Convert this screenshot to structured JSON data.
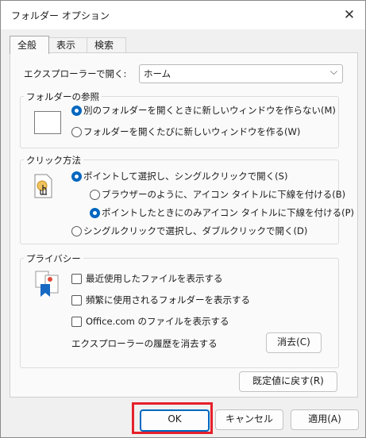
{
  "window": {
    "title": "フォルダー オプション",
    "close_glyph": "✕"
  },
  "tabs": [
    "全般",
    "表示",
    "検索"
  ],
  "general": {
    "open_in_label": "エクスプローラーで開く:",
    "open_in_value": "ホーム",
    "browse_folders": {
      "title": "フォルダーの参照",
      "option_same_window": "別のフォルダーを開くときに新しいウィンドウを作らない(M)",
      "option_new_window": "フォルダーを開くたびに新しいウィンドウを作る(W)",
      "selected": "option_same_window"
    },
    "click_items": {
      "title": "クリック方法",
      "option_single_click": "ポイントして選択し、シングルクリックで開く(S)",
      "sub_option_browser": "ブラウザーのように、アイコン タイトルに下線を付ける(B)",
      "sub_option_point": "ポイントしたときにのみアイコン タイトルに下線を付ける(P)",
      "option_double_click": "シングルクリックで選択し、ダブルクリックで開く(D)",
      "selected": "option_single_click",
      "sub_selected": "sub_option_point"
    },
    "privacy": {
      "title": "プライバシー",
      "check_recent_files": "最近使用したファイルを表示する",
      "check_frequent_folders": "頻繁に使用されるフォルダーを表示する",
      "check_office": "Office.com のファイルを表示する",
      "check_recent_files_checked": false,
      "check_frequent_folders_checked": false,
      "check_office_checked": false,
      "clear_history_label": "エクスプローラーの履歴を消去する",
      "clear_button": "消去(C)"
    },
    "restore_defaults_button": "既定値に戻す(R)"
  },
  "footer": {
    "ok": "OK",
    "cancel": "キャンセル",
    "apply": "適用(A)"
  },
  "colors": {
    "accent": "#0067c0",
    "highlight_box": "#e5202a"
  }
}
